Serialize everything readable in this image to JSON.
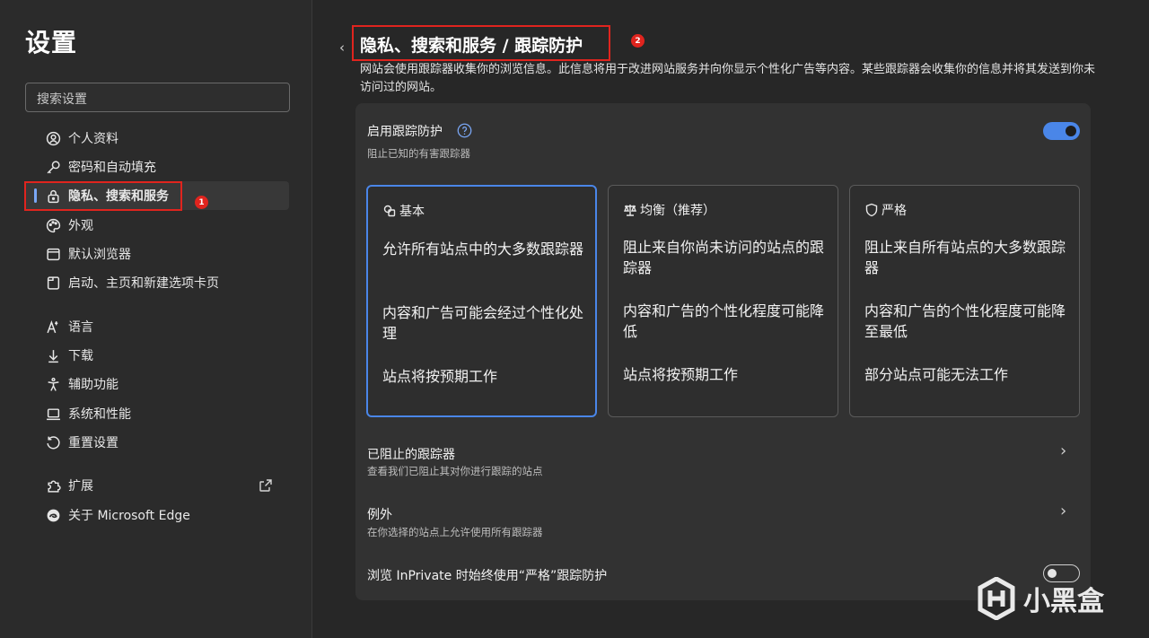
{
  "sidebar": {
    "title": "设置",
    "search_placeholder": "搜索设置",
    "items": [
      {
        "label": "个人资料",
        "icon": "profile-icon"
      },
      {
        "label": "密码和自动填充",
        "icon": "key-icon"
      },
      {
        "label": "隐私、搜索和服务",
        "icon": "lock-icon",
        "active": true
      },
      {
        "label": "外观",
        "icon": "palette-icon"
      },
      {
        "label": "默认浏览器",
        "icon": "browser-icon"
      },
      {
        "label": "启动、主页和新建选项卡页",
        "icon": "home-tab-icon"
      },
      {
        "label": "语言",
        "icon": "language-icon"
      },
      {
        "label": "下载",
        "icon": "download-icon"
      },
      {
        "label": "辅助功能",
        "icon": "accessibility-icon"
      },
      {
        "label": "系统和性能",
        "icon": "laptop-icon"
      },
      {
        "label": "重置设置",
        "icon": "reset-icon"
      },
      {
        "label": "扩展",
        "icon": "puzzle-icon"
      },
      {
        "label": "关于 Microsoft Edge",
        "icon": "edge-icon"
      }
    ]
  },
  "annotations": {
    "badge1": "1",
    "badge2": "2"
  },
  "main": {
    "title": "隐私、搜索和服务 / 跟踪防护",
    "description": "网站会使用跟踪器收集你的浏览信息。此信息将用于改进网站服务并向你显示个性化广告等内容。某些跟踪器会收集你的信息并将其发送到你未访问过的网站。",
    "enable": {
      "title": "启用跟踪防护",
      "subtitle": "阻止已知的有害跟踪器",
      "on": true
    },
    "levels": [
      {
        "name": "基本",
        "icon": "basic-icon",
        "selected": true,
        "lines": [
          "允许所有站点中的大多数跟踪器",
          "内容和广告可能会经过个性化处理",
          "站点将按预期工作"
        ]
      },
      {
        "name": "均衡（推荐）",
        "icon": "balance-scale-icon",
        "selected": false,
        "lines": [
          "阻止来自你尚未访问的站点的跟踪器",
          "内容和广告的个性化程度可能降低",
          "站点将按预期工作"
        ]
      },
      {
        "name": "严格",
        "icon": "shield-icon",
        "selected": false,
        "lines": [
          "阻止来自所有站点的大多数跟踪器",
          "内容和广告的个性化程度可能降至最低",
          "部分站点可能无法工作"
        ]
      }
    ],
    "blocked": {
      "title": "已阻止的跟踪器",
      "subtitle": "查看我们已阻止其对你进行跟踪的站点"
    },
    "exceptions": {
      "title": "例外",
      "subtitle": "在你选择的站点上允许使用所有跟踪器"
    },
    "inprivate": {
      "title": "浏览 InPrivate 时始终使用“严格”跟踪防护",
      "on": false
    }
  },
  "watermark": {
    "text": "小黑盒"
  },
  "colors": {
    "accent": "#4a86e8",
    "annotation": "#e0241e"
  }
}
